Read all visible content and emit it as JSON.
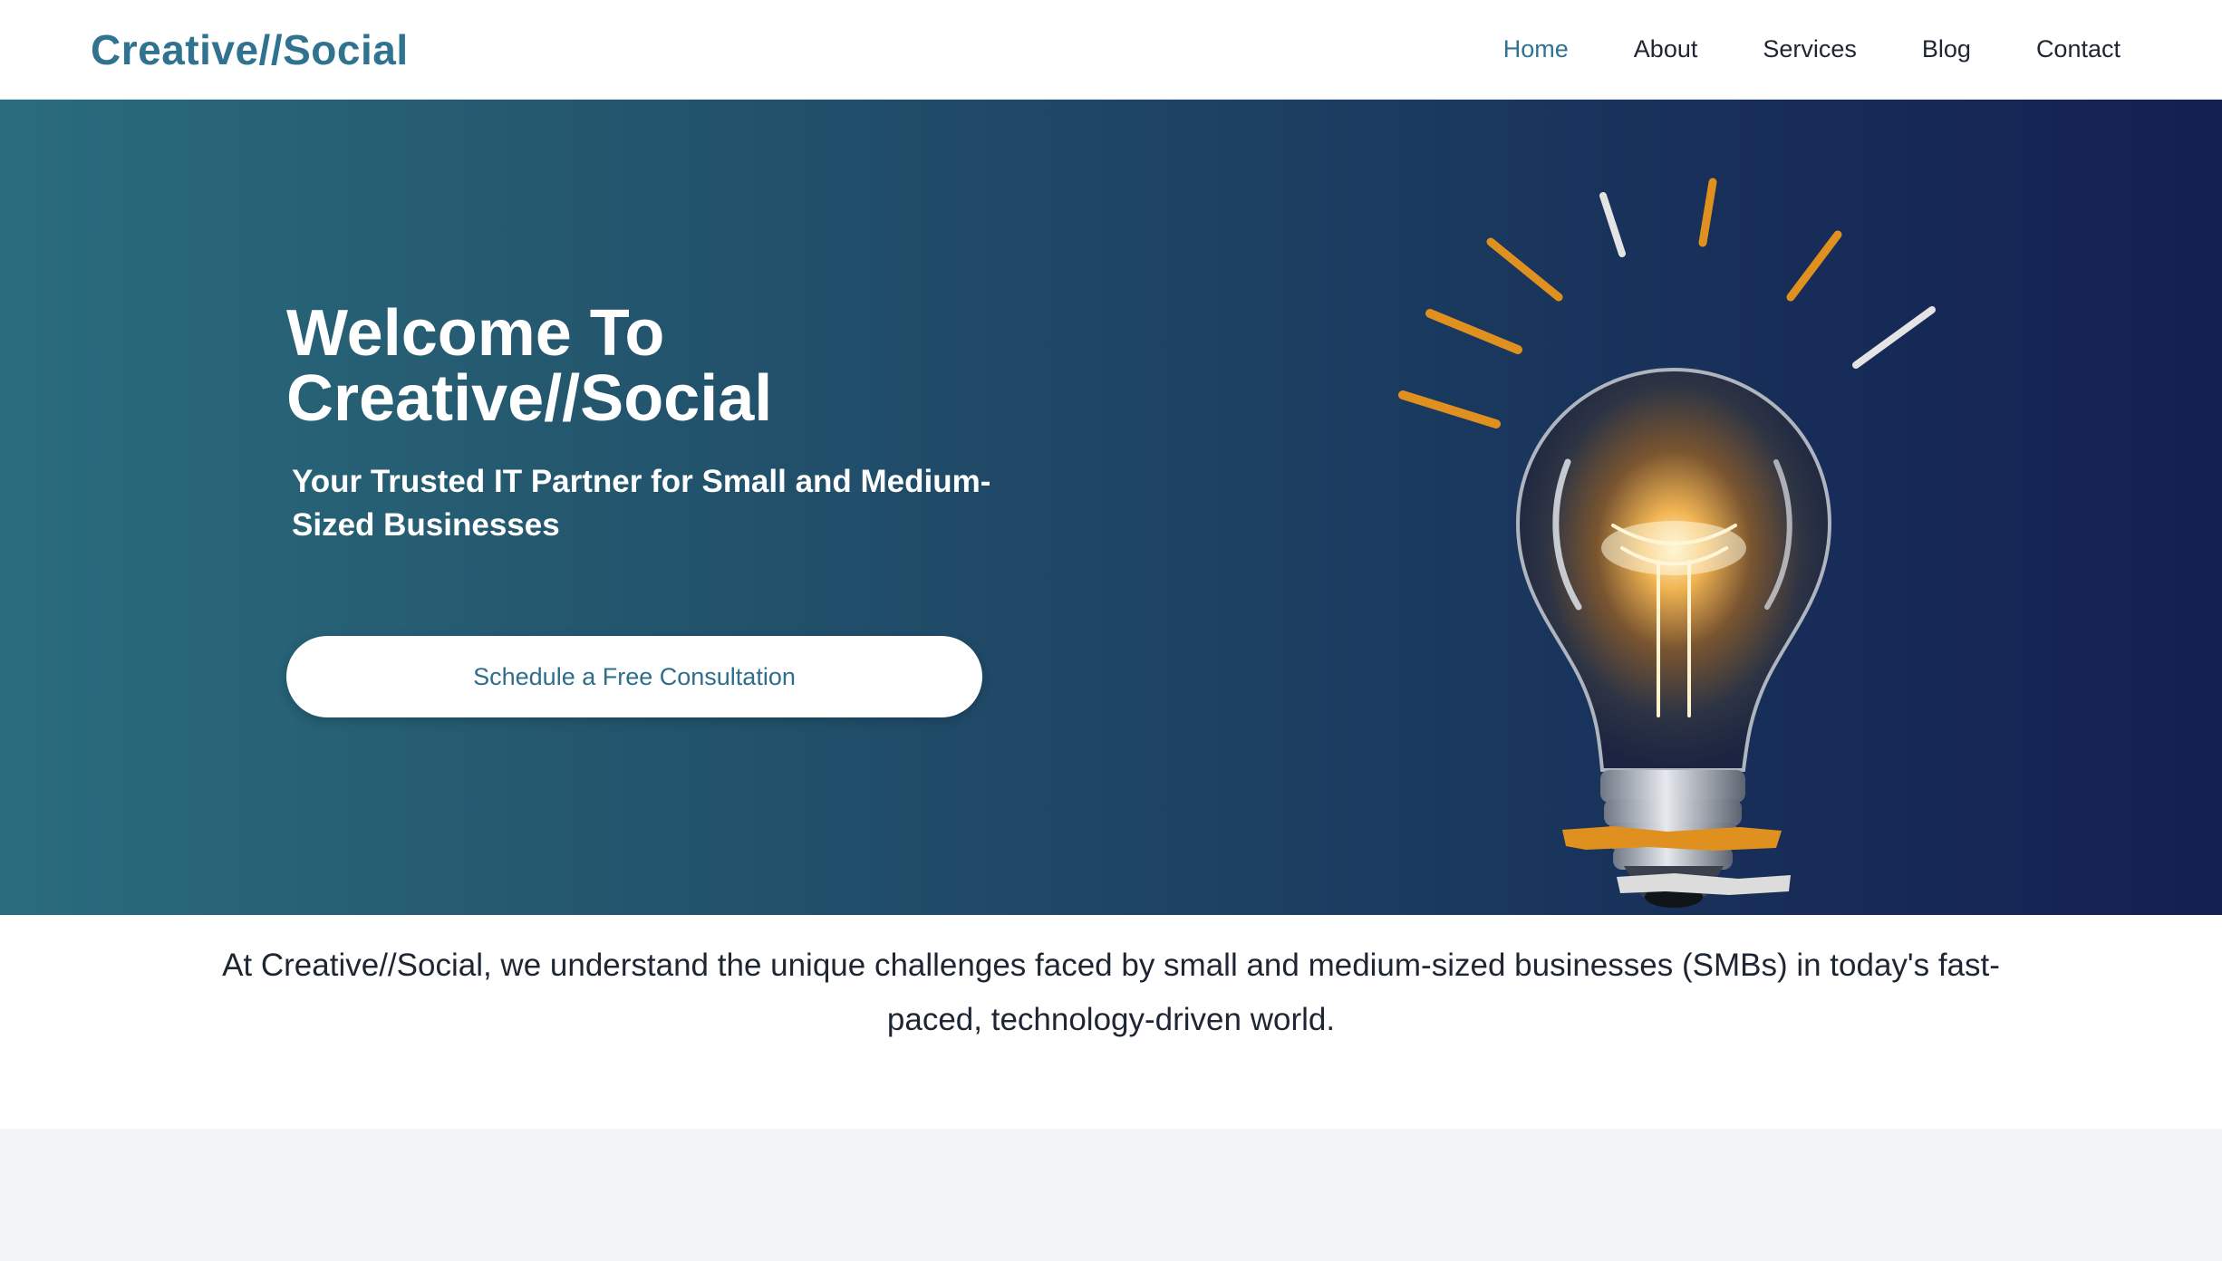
{
  "header": {
    "logo": "Creative//Social",
    "nav": {
      "home": "Home",
      "about": "About",
      "services": "Services",
      "blog": "Blog",
      "contact": "Contact"
    },
    "active_item": "Home"
  },
  "hero": {
    "title_line1": "Welcome To",
    "title_line2": "Creative//Social",
    "subtitle": "Your Trusted IT Partner for Small and Medium-Sized Businesses",
    "cta_label": "Schedule a Free Consultation",
    "image_icon": "lightbulb-icon"
  },
  "intro": {
    "text": "At Creative//Social, we understand the unique challenges faced by small and medium-sized businesses (SMBs) in today's fast-paced, technology-driven world."
  },
  "colors": {
    "brand": "#2f7391",
    "hero_gradient_start": "#2a6c7e",
    "hero_gradient_end": "#141f52",
    "accent_orange": "#e0901f"
  }
}
